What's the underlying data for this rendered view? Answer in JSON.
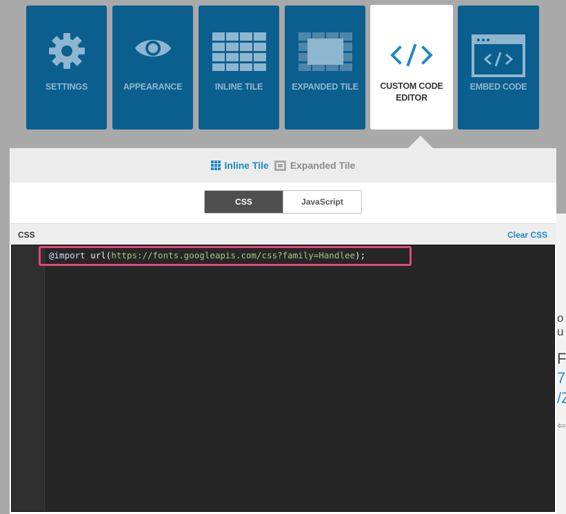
{
  "tiles": [
    {
      "label": "SETTINGS",
      "icon": "gear-icon"
    },
    {
      "label": "APPEARANCE",
      "icon": "eye-icon"
    },
    {
      "label": "INLINE TILE",
      "icon": "grid-icon"
    },
    {
      "label": "EXPANDED TILE",
      "icon": "expanded-tile-icon"
    },
    {
      "label": "CUSTOM CODE EDITOR",
      "icon": "code-icon",
      "active": true
    },
    {
      "label": "EMBED CODE",
      "icon": "browser-code-icon"
    }
  ],
  "subtabs": {
    "inline": "Inline Tile",
    "expanded": "Expanded Tile",
    "active": "inline"
  },
  "toggle": {
    "css": "CSS",
    "js": "JavaScript",
    "selected": "css"
  },
  "editor": {
    "title": "CSS",
    "clear_label": "Clear CSS",
    "code": {
      "at_rule": "@import",
      "fn": "url(",
      "url": "https://fonts.googleapis.com/css?family=Handlee",
      "end": ");"
    }
  },
  "background_fragments": [
    "o",
    "u",
    "F",
    "7",
    "/Z",
    "⇐"
  ],
  "colors": {
    "tile_bg": "#0b5f8f",
    "tile_text": "#8fb6cf",
    "accent": "#1a8ac6",
    "highlight": "#e0487a",
    "editor_bg": "#262626"
  }
}
